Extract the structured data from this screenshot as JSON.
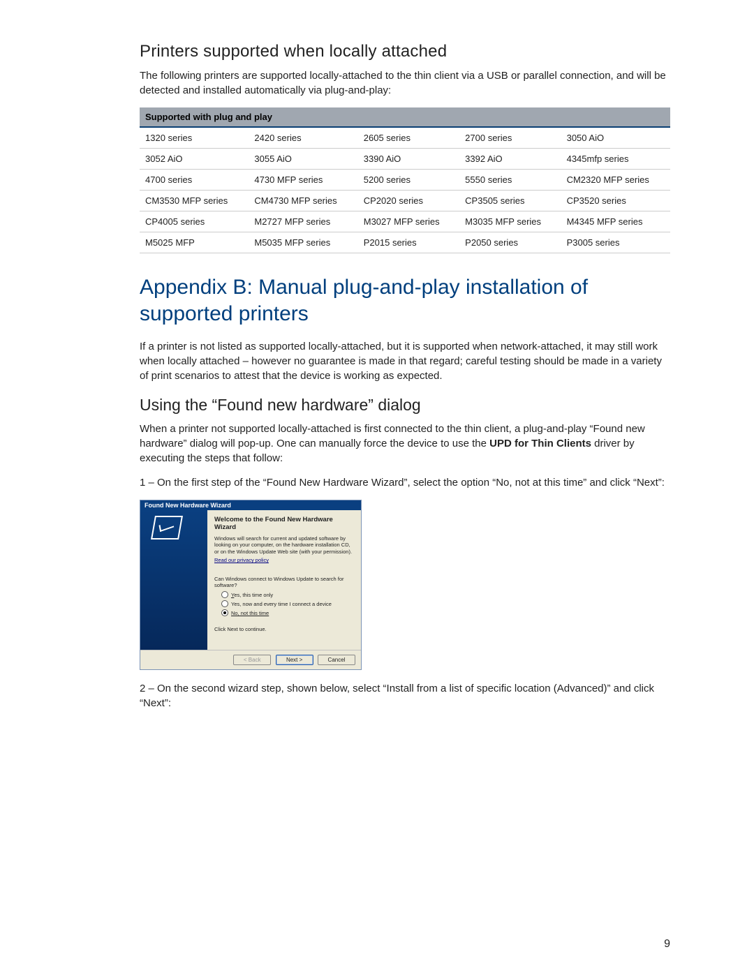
{
  "section1": {
    "heading": "Printers supported when locally attached",
    "intro": "The following printers are supported locally-attached to the thin client via a USB or parallel connection, and will be detected and installed automatically via plug-and-play:"
  },
  "table": {
    "header": "Supported with plug and play",
    "rows": [
      [
        "1320 series",
        "2420 series",
        "2605 series",
        "2700 series",
        "3050 AiO"
      ],
      [
        "3052 AiO",
        "3055 AiO",
        "3390 AiO",
        "3392 AiO",
        "4345mfp series"
      ],
      [
        "4700 series",
        "4730 MFP series",
        "5200 series",
        "5550 series",
        "CM2320 MFP series"
      ],
      [
        "CM3530 MFP series",
        "CM4730 MFP series",
        "CP2020 series",
        "CP3505 series",
        "CP3520 series"
      ],
      [
        "CP4005 series",
        "M2727 MFP series",
        "M3027 MFP series",
        "M3035 MFP series",
        "M4345 MFP series"
      ],
      [
        "M5025 MFP",
        "M5035 MFP series",
        "P2015 series",
        "P2050 series",
        "P3005 series"
      ]
    ]
  },
  "appendix": {
    "heading": "Appendix B: Manual plug-and-play installation of supported printers",
    "intro": "If a printer is not listed as supported locally-attached, but it is supported when network-attached, it may still work when locally attached – however no guarantee is made in that regard; careful testing should be made in a variety of print scenarios to attest that the device is working as expected."
  },
  "using": {
    "heading": "Using the “Found new hardware” dialog",
    "p1a": "When a printer not supported locally-attached is first connected to the thin client, a plug-and-play “Found new hardware” dialog will pop-up. One can manually force the device to use the ",
    "p1bold": "UPD for Thin Clients",
    "p1b": " driver by executing the steps that follow:",
    "step1": "1 – On the first step of the “Found New Hardware Wizard”, select the option “No, not at this time” and click “Next”:",
    "step2": "2 – On the second wizard step, shown below, select “Install from a list of specific location (Advanced)” and click “Next”:"
  },
  "wizard": {
    "title": "Found New Hardware Wizard",
    "welcome": "Welcome to the Found New Hardware Wizard",
    "desc": "Windows will search for current and updated software by looking on your computer, on the hardware installation CD, or on the Windows Update Web site (with your permission).",
    "privacy": "Read our privacy policy",
    "question": "Can Windows connect to Windows Update to search for software?",
    "opt1": "Yes, this time only",
    "opt2": "Yes, now and every time I connect a device",
    "opt3": "No, not this time",
    "continue": "Click Next to continue.",
    "btn_back": "< Back",
    "btn_next": "Next >",
    "btn_cancel": "Cancel"
  },
  "page_number": "9"
}
